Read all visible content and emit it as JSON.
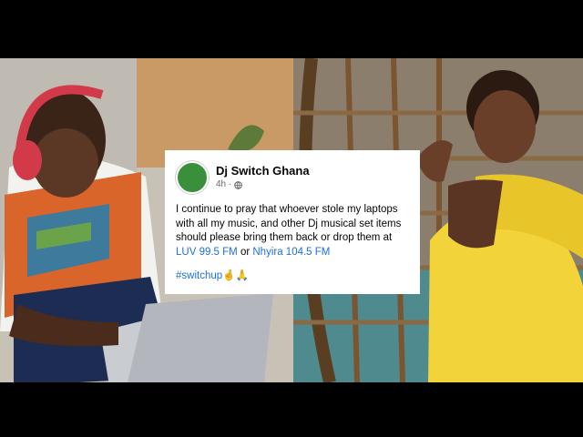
{
  "post": {
    "author": "Dj Switch Ghana",
    "time": "4h ·",
    "text_part1": "I continue to pray that whoever stole my laptops with all my music, and other Dj musical set items should please bring them back or drop them at ",
    "station1": "LUV 99.5 FM",
    "text_or": " or ",
    "station2": "Nhyira 104.5 FM",
    "hashtag": "#switchup",
    "emojis": "🤞🙏"
  },
  "colors": {
    "link": "#216fdb",
    "black_bar": "#000000"
  },
  "icons": {
    "visibility": "globe-icon"
  }
}
